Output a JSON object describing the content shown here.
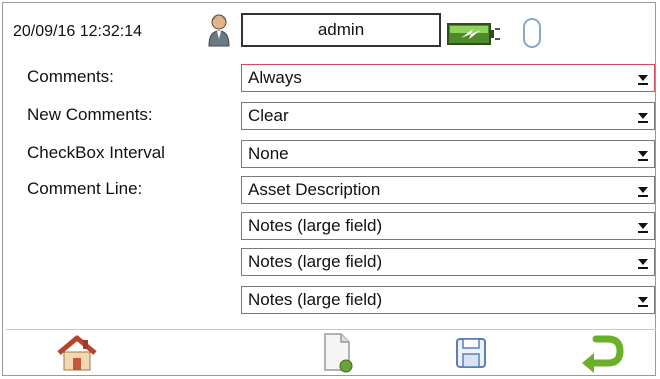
{
  "header": {
    "datetime": "20/09/16 12:32:14",
    "user": "admin",
    "icons": [
      "user-icon",
      "battery-charging-icon",
      "mouse-icon"
    ]
  },
  "settings": {
    "rows": [
      {
        "label": "Comments:",
        "value": "Always",
        "active": true
      },
      {
        "label": "New Comments:",
        "value": "Clear"
      },
      {
        "label": "CheckBox Interval",
        "value": "None"
      },
      {
        "label": "Comment Line:",
        "value": "Asset Description"
      },
      {
        "label": "",
        "value": "Notes (large field)"
      },
      {
        "label": "",
        "value": "Notes (large field)"
      },
      {
        "label": "",
        "value": "Notes (large field)"
      }
    ]
  },
  "toolbar": {
    "icons": [
      "home-icon",
      "new-document-icon",
      "save-icon",
      "back-icon"
    ],
    "colors": {
      "home": "#c8553a",
      "doc_badge": "#6aa33a",
      "save": "#5a7fb5",
      "back": "#6bb02a"
    }
  }
}
